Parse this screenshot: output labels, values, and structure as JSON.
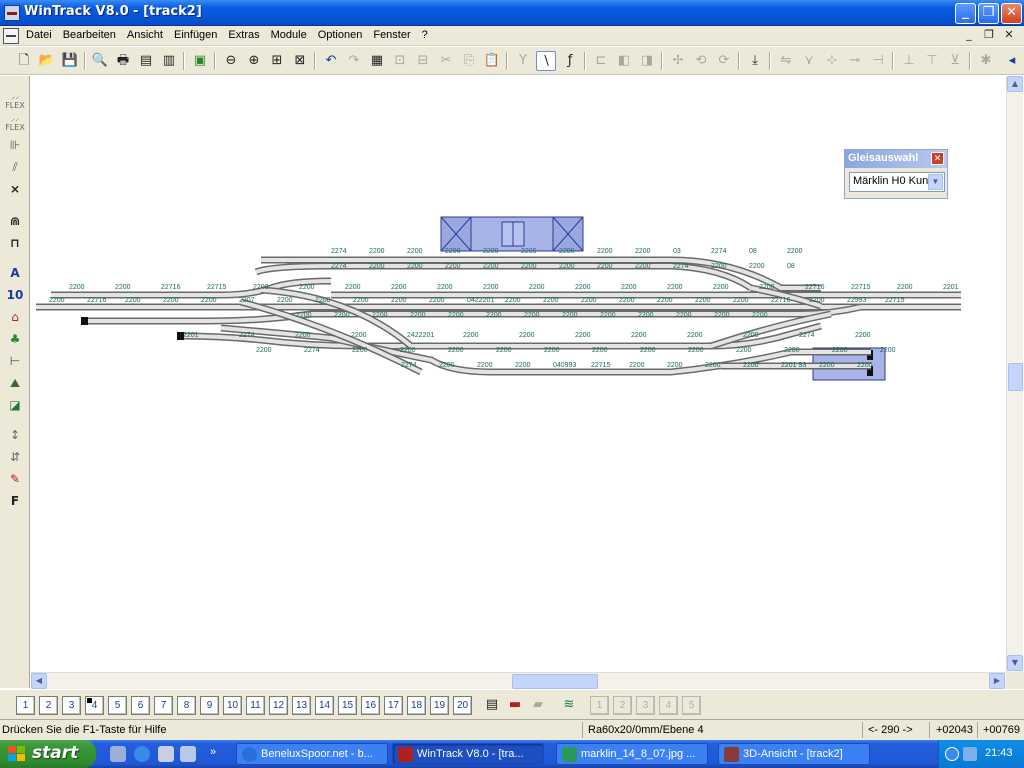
{
  "window": {
    "title": "WinTrack  V8.0 - [track2]",
    "buttons": [
      "_",
      "❐",
      "✕"
    ]
  },
  "menu": {
    "items": [
      "Datei",
      "Bearbeiten",
      "Ansicht",
      "Einfügen",
      "Extras",
      "Module",
      "Optionen",
      "Fenster",
      "?"
    ],
    "mdi_buttons": [
      "_",
      "❐",
      "✕"
    ]
  },
  "gleisauswahl": {
    "title": "Gleisauswahl",
    "selected": "Märklin H0 Kun"
  },
  "layers": {
    "numbers": [
      "1",
      "2",
      "3",
      "4",
      "5",
      "6",
      "7",
      "8",
      "9",
      "10",
      "11",
      "12",
      "13",
      "14",
      "15",
      "16",
      "17",
      "18",
      "19",
      "20"
    ],
    "active": "4"
  },
  "status": {
    "hint": "Drücken Sie die  F1-Taste für Hilfe",
    "mode": "Ra60x20/0mm/Ebene 4",
    "angle": "<- 290 ->",
    "x": "+02043",
    "y": "+00769"
  },
  "taskbar": {
    "start": "start",
    "tasks": [
      {
        "label": "BeneluxSpoor.net - b...",
        "color": "#2a6fd8"
      },
      {
        "label": "WinTrack  V8.0 - [tra...",
        "color": "#b02020"
      },
      {
        "label": "marklin_14_8_07.jpg ...",
        "color": "#2a9a5a"
      },
      {
        "label": "3D-Ansicht - [track2]",
        "color": "#8a3a3a"
      }
    ],
    "clock": "21:43"
  },
  "track_labels": {
    "row1": [
      "2274",
      "2200",
      "2200",
      "2200",
      "2200",
      "2200",
      "2200",
      "2200",
      "2200",
      "03",
      "2274",
      "08",
      "2200"
    ],
    "row2": [
      "2274",
      "2200",
      "2200",
      "2200",
      "2200",
      "2200",
      "2200",
      "2200",
      "2200",
      "2274",
      "2200",
      "2200",
      "08"
    ],
    "row3": [
      "2200",
      "2200",
      "22716",
      "22715",
      "2200",
      "2200",
      "2200",
      "2200",
      "2200",
      "2200",
      "2200",
      "2200",
      "2200",
      "2200",
      "2200",
      "2200",
      "22716",
      "22715",
      "2200",
      "2201"
    ],
    "row4": [
      "2200",
      "22716",
      "2200",
      "2200",
      "2200",
      "2207",
      "2200",
      "2200",
      "2200",
      "2200",
      "2200",
      "0422201",
      "2200",
      "2200",
      "2200",
      "2200",
      "2200",
      "2200",
      "2200",
      "22716",
      "2200",
      "22993",
      "22715"
    ],
    "row5": [
      "2200",
      "2200",
      "2200",
      "2200",
      "2200",
      "2200",
      "2200",
      "2200",
      "2200",
      "2200",
      "2200",
      "2200",
      "2200"
    ],
    "row6": [
      "2201",
      "2274",
      "2200",
      "2200",
      "2422201",
      "2200",
      "2200",
      "2200",
      "2200",
      "2200",
      "2200",
      "2274",
      "2200"
    ],
    "row7": [
      "2200",
      "2274",
      "2200",
      "2200",
      "2200",
      "2200",
      "2200",
      "2200",
      "2200",
      "2200",
      "2200",
      "2200",
      "2200",
      "2200"
    ],
    "row8": [
      "2274",
      "2200",
      "2200",
      "2200",
      "040993",
      "22715",
      "2200",
      "2200",
      "2200",
      "2200",
      "2201 93",
      "2200",
      "2200"
    ]
  }
}
